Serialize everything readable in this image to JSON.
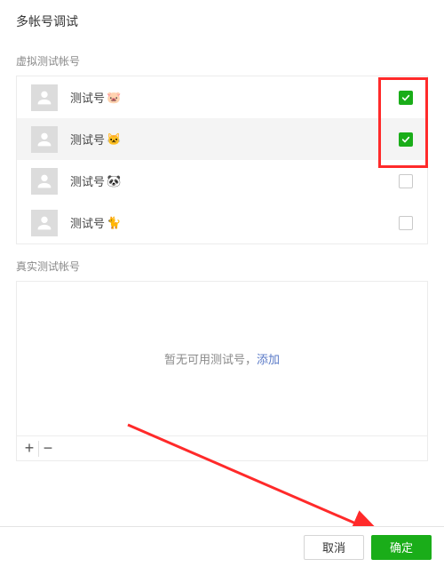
{
  "title": "多帐号调试",
  "sections": {
    "virtual_label": "虚拟测试帐号",
    "real_label": "真实测试帐号"
  },
  "virtual_accounts": [
    {
      "name": "测试号",
      "emoji": "🐷",
      "checked": true,
      "hover": false
    },
    {
      "name": "测试号",
      "emoji": "🐱",
      "checked": true,
      "hover": true
    },
    {
      "name": "测试号",
      "emoji": "🐼",
      "checked": false,
      "hover": false
    },
    {
      "name": "测试号",
      "emoji": "🐈",
      "checked": false,
      "hover": false
    }
  ],
  "empty_state": {
    "prefix": "暂无可用测试号，",
    "link": "添加"
  },
  "toolbar": {
    "add": "+",
    "remove": "−"
  },
  "footer": {
    "cancel": "取消",
    "confirm": "确定"
  },
  "colors": {
    "accent": "#1aad19",
    "highlight": "#ff2a2a"
  }
}
